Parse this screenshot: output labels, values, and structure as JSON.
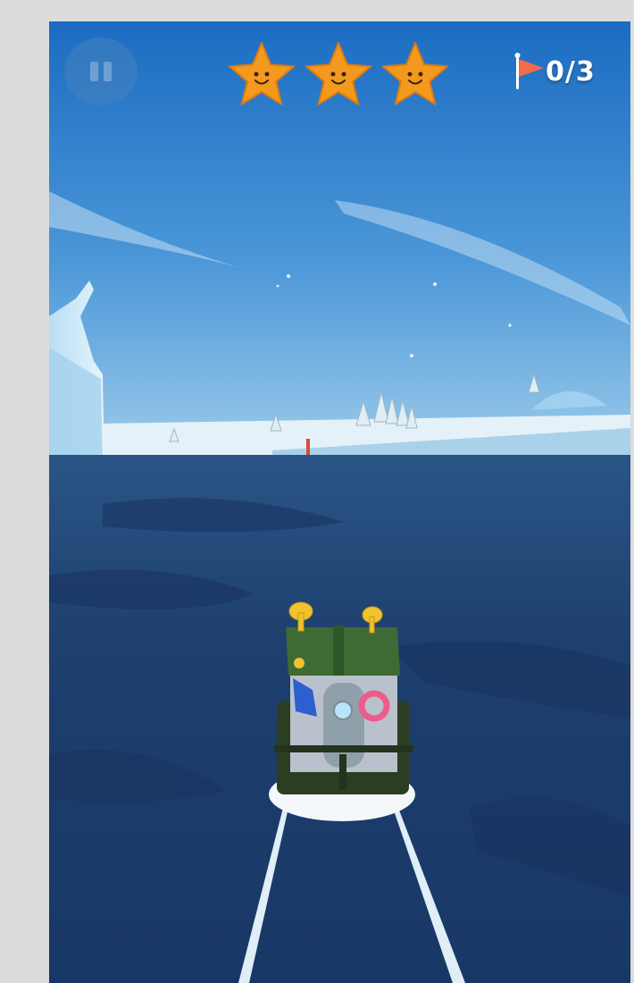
{
  "hud": {
    "flag_progress": "0/3",
    "stars_earned": 3,
    "stars_total": 3
  },
  "icons": {
    "pause": "pause-icon",
    "star": "starfish-icon",
    "flag": "flag-icon"
  },
  "colors": {
    "sky_top": "#1f6fc4",
    "sky_bottom": "#8cc3e8",
    "water": "#1d3c6e",
    "star": "#f39a1e",
    "flag": "#f26b4b"
  }
}
